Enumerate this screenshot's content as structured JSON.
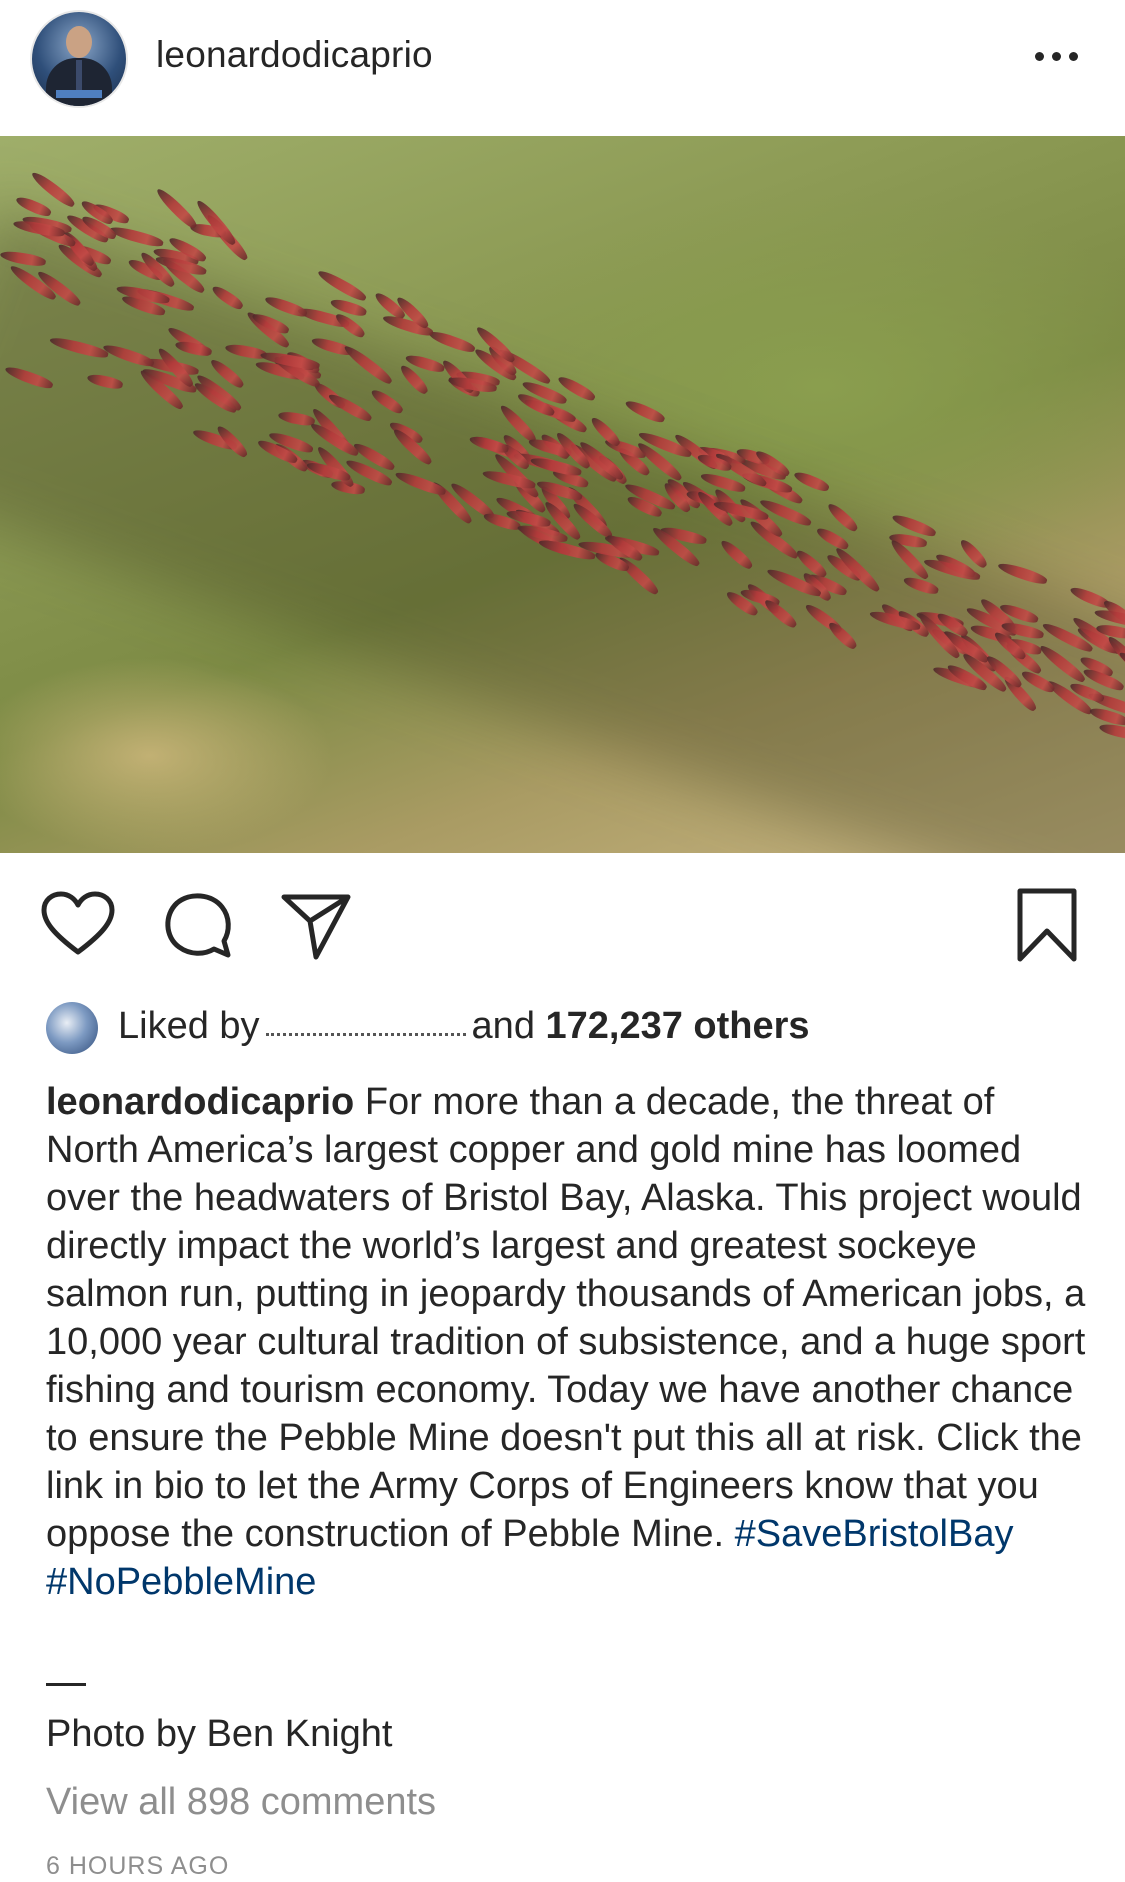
{
  "post": {
    "username": "leonardodicaprio",
    "more_icon": "more-horizontal-icon",
    "photo_alt": "Sockeye salmon swimming in a shallow river",
    "actions": {
      "like_icon": "heart-icon",
      "comment_icon": "comment-icon",
      "share_icon": "send-icon",
      "save_icon": "bookmark-icon"
    },
    "likes": {
      "prefix": "Liked by",
      "middle": "and",
      "count": "172,237 others"
    },
    "caption": {
      "username": "leonardodicaprio",
      "text": "For more than a decade, the threat of North America’s largest copper and gold mine has loomed over the headwaters of Bristol Bay, Alaska. This project would directly impact the world’s largest and greatest sockeye salmon run, putting in jeopardy thousands of American jobs, a 10,000 year cultural tradition of subsistence, and a huge sport fishing and tourism economy. Today we have another chance to ensure the Pebble Mine doesn't put this all at risk. Click the link in bio to let the Army Corps of Engineers know that you oppose the construction of Pebble Mine.",
      "hashtags": [
        "#SaveBristolBay",
        "#NoPebbleMine"
      ]
    },
    "separator": "—",
    "credit": "Photo by Ben Knight",
    "view_comments": "View all 898 comments",
    "timestamp": "6 HOURS AGO"
  }
}
